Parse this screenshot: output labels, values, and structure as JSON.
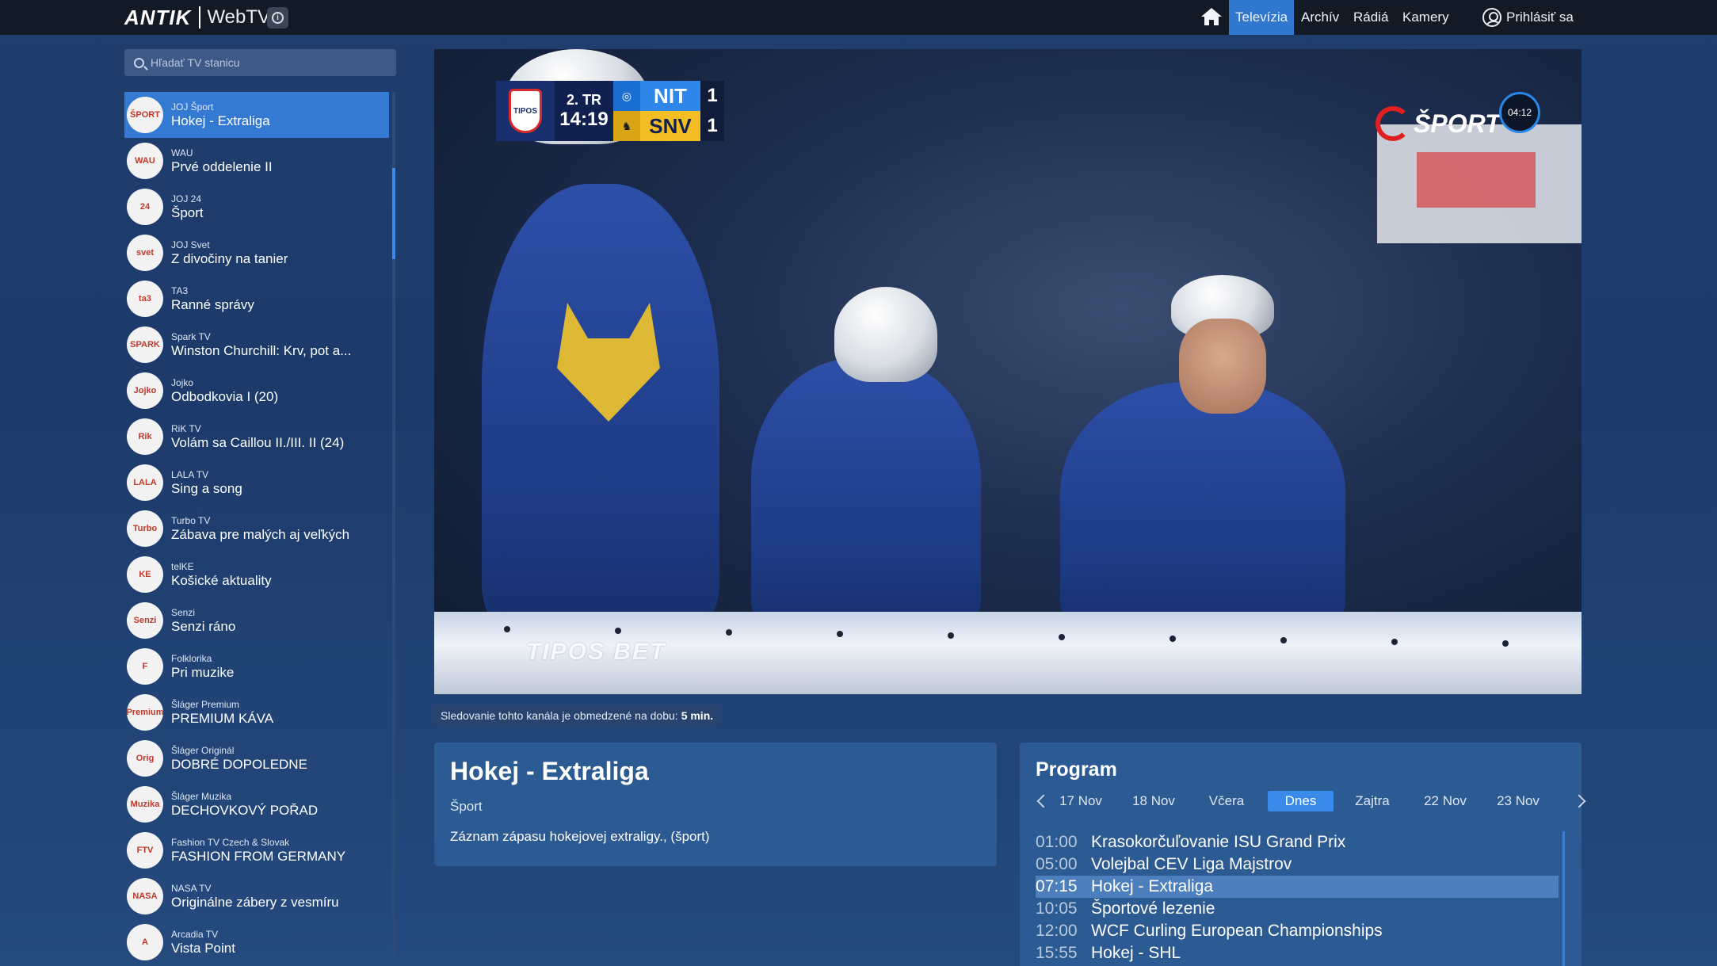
{
  "header": {
    "brand": "ANTIK",
    "product": "WebTV",
    "info_icon": "info-icon",
    "nav": [
      {
        "label": "Televízia",
        "active": true
      },
      {
        "label": "Archív"
      },
      {
        "label": "Rádiá"
      },
      {
        "label": "Kamery"
      }
    ],
    "home_icon": "home-icon",
    "login_label": "Prihlásiť sa"
  },
  "sidebar": {
    "search_placeholder": "Hľadať TV stanicu",
    "channels": [
      {
        "name": "JOJ Šport",
        "program": "Hokej - Extraliga",
        "logo": "ŠPORT",
        "active": true
      },
      {
        "name": "WAU",
        "program": "Prvé oddelenie II",
        "logo": "WAU"
      },
      {
        "name": "JOJ 24",
        "program": "Šport",
        "logo": "24"
      },
      {
        "name": "JOJ Svet",
        "program": "Z divočiny na tanier",
        "logo": "svet"
      },
      {
        "name": "TA3",
        "program": "Ranné správy",
        "logo": "ta3"
      },
      {
        "name": "Spark TV",
        "program": "Winston Churchill: Krv, pot a...",
        "logo": "SPARK"
      },
      {
        "name": "Jojko",
        "program": "Odbodkovia I (20)",
        "logo": "Jojko"
      },
      {
        "name": "RiK TV",
        "program": "Volám sa Caillou II./III. II (24)",
        "logo": "Rik"
      },
      {
        "name": "LALA TV",
        "program": "Sing a song",
        "logo": "LALA"
      },
      {
        "name": "Turbo TV",
        "program": "Zábava pre malých aj veľkých",
        "logo": "Turbo"
      },
      {
        "name": "telKE",
        "program": "Košické aktuality",
        "logo": "KE"
      },
      {
        "name": "Senzi",
        "program": "Senzi ráno",
        "logo": "Senzi"
      },
      {
        "name": "Folklorika",
        "program": "Pri muzike",
        "logo": "F"
      },
      {
        "name": "Šláger Premium",
        "program": "PREMIUM KÁVA",
        "logo": "Premium"
      },
      {
        "name": "Šláger Originál",
        "program": "DOBRÉ DOPOLEDNE",
        "logo": "Orig"
      },
      {
        "name": "Šláger Muzika",
        "program": "DECHOVKOVÝ POŘAD",
        "logo": "Muzika"
      },
      {
        "name": "Fashion TV Czech & Slovak",
        "program": "FASHION FROM GERMANY",
        "logo": "FTV"
      },
      {
        "name": "NASA TV",
        "program": "Originálne zábery z vesmíru",
        "logo": "NASA"
      },
      {
        "name": "Arcadia TV",
        "program": "Vista Point",
        "logo": "A"
      }
    ]
  },
  "player": {
    "scorebug": {
      "league_logo": "TIPOS",
      "period": "2. TR",
      "clock": "14:19",
      "teams": [
        {
          "abbr": "NIT",
          "score": "1"
        },
        {
          "abbr": "SNV",
          "score": "1"
        }
      ]
    },
    "channel_logo_text": "ŠPORT",
    "countdown": "04:12",
    "sponsor": "TIPOS BET"
  },
  "notice": {
    "text": "Sledovanie tohto kanála je obmedzené na dobu:",
    "duration": "5 min."
  },
  "info": {
    "title": "Hokej - Extraliga",
    "genre": "Šport",
    "description": "Záznam zápasu hokejovej extraligy., (šport)"
  },
  "program": {
    "heading": "Program",
    "days": [
      {
        "label": "17 Nov"
      },
      {
        "label": "18 Nov"
      },
      {
        "label": "Včera"
      },
      {
        "label": "Dnes",
        "active": true
      },
      {
        "label": "Zajtra"
      },
      {
        "label": "22 Nov"
      },
      {
        "label": "23 Nov"
      }
    ],
    "items": [
      {
        "time": "01:00",
        "title": "Krasokorčuľovanie ISU Grand Prix"
      },
      {
        "time": "05:00",
        "title": "Volejbal CEV Liga Majstrov"
      },
      {
        "time": "07:15",
        "title": "Hokej - Extraliga",
        "active": true
      },
      {
        "time": "10:05",
        "title": "Športové lezenie"
      },
      {
        "time": "12:00",
        "title": "WCF Curling European Championships"
      },
      {
        "time": "15:55",
        "title": "Hokej - SHL"
      }
    ]
  },
  "colors": {
    "accent": "#2f77cf",
    "background": "#1f3d6d",
    "topbar": "#121a26",
    "card": "#2c5a92"
  }
}
